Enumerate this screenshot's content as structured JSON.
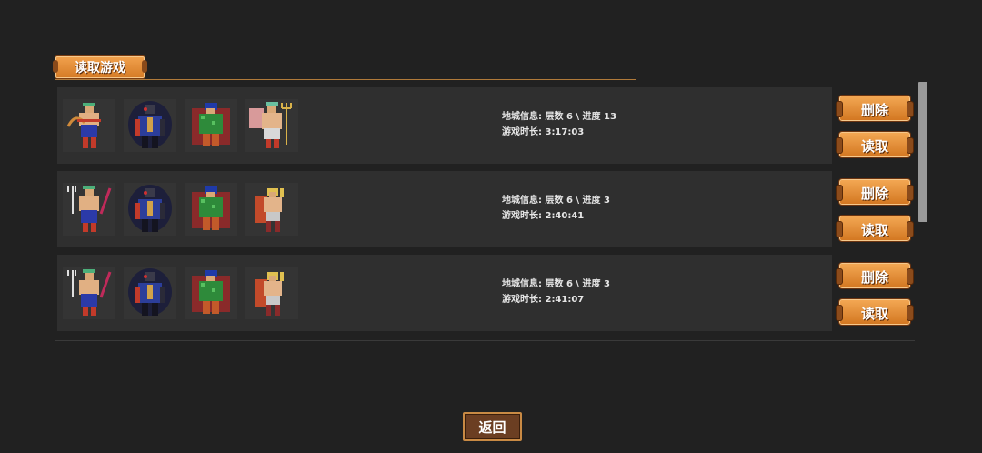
{
  "panel": {
    "title": "读取游戏"
  },
  "slots": [
    {
      "portraits": [
        "archer-hero-icon",
        "dark-knight-icon",
        "green-warrior-icon",
        "trident-priest-icon"
      ],
      "info_line1": "地城信息: 层数 6 \\ 进度 13",
      "info_line2": "游戏时长: 3:17:03",
      "delete_label": "删除",
      "load_label": "读取"
    },
    {
      "portraits": [
        "trident-mage-icon",
        "dark-knight-icon",
        "green-warrior-icon",
        "blonde-fighter-icon"
      ],
      "info_line1": "地城信息: 层数 6 \\ 进度 3",
      "info_line2": "游戏时长: 2:40:41",
      "delete_label": "删除",
      "load_label": "读取"
    },
    {
      "portraits": [
        "trident-mage-icon",
        "dark-knight-icon",
        "green-warrior-icon",
        "blonde-fighter-icon"
      ],
      "info_line1": "地城信息: 层数 6 \\ 进度 3",
      "info_line2": "游戏时长: 2:41:07",
      "delete_label": "删除",
      "load_label": "读取"
    }
  ],
  "back_button": {
    "label": "返回"
  },
  "colors": {
    "button_orange": "#e08a30",
    "background": "#212121",
    "slot_bg": "#2f2f2f"
  }
}
